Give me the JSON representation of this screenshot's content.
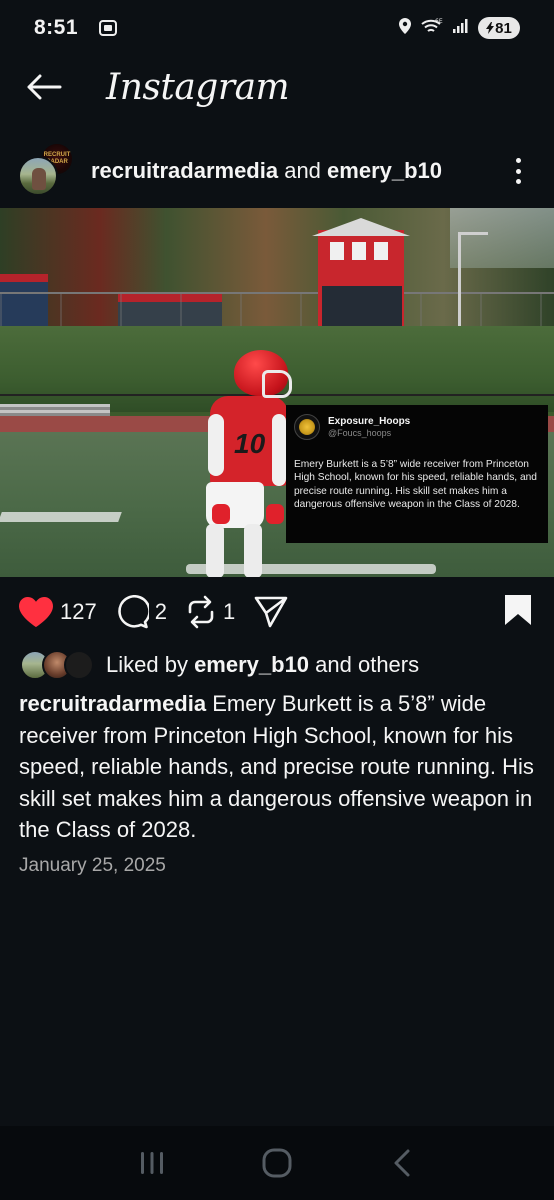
{
  "status_bar": {
    "time": "8:51",
    "network": "6E",
    "battery": "81"
  },
  "header": {
    "title": "Instagram"
  },
  "post": {
    "user1": "recruitradarmedia",
    "connector": " and ",
    "user2": "emery_b10",
    "avatar_back_text": "RECRUIT RADAR",
    "image": {
      "jersey_number": "10",
      "tweet": {
        "name": "Exposure_Hoops",
        "handle": "@Foucs_hoops",
        "text": "Emery Burkett is a 5’8” wide receiver from Princeton High School, known for his speed, reliable hands, and precise route running. His skill set makes him a dangerous offensive weapon in the Class of 2028."
      }
    },
    "likes_count": "127",
    "comments_count": "2",
    "reposts_count": "1",
    "liked_by_prefix": "Liked by ",
    "liked_by_user": "emery_b10",
    "liked_by_suffix": " and others",
    "caption_user": "recruitradarmedia",
    "caption_text": " Emery Burkett is a 5’8” wide receiver from Princeton High School, known for his speed, reliable hands, and precise route running. His skill set makes him a dangerous offensive weapon in the Class of 2028.",
    "date": "January 25, 2025"
  },
  "colors": {
    "background": "#0c1014",
    "like_red": "#ff3040",
    "text": "#f5f5f5",
    "muted": "#a8a8a8"
  },
  "icons": [
    "back-arrow-icon",
    "more-vertical-icon",
    "heart-icon",
    "comment-icon",
    "repost-icon",
    "share-icon",
    "bookmark-icon",
    "recents-icon",
    "home-icon",
    "back-icon"
  ]
}
